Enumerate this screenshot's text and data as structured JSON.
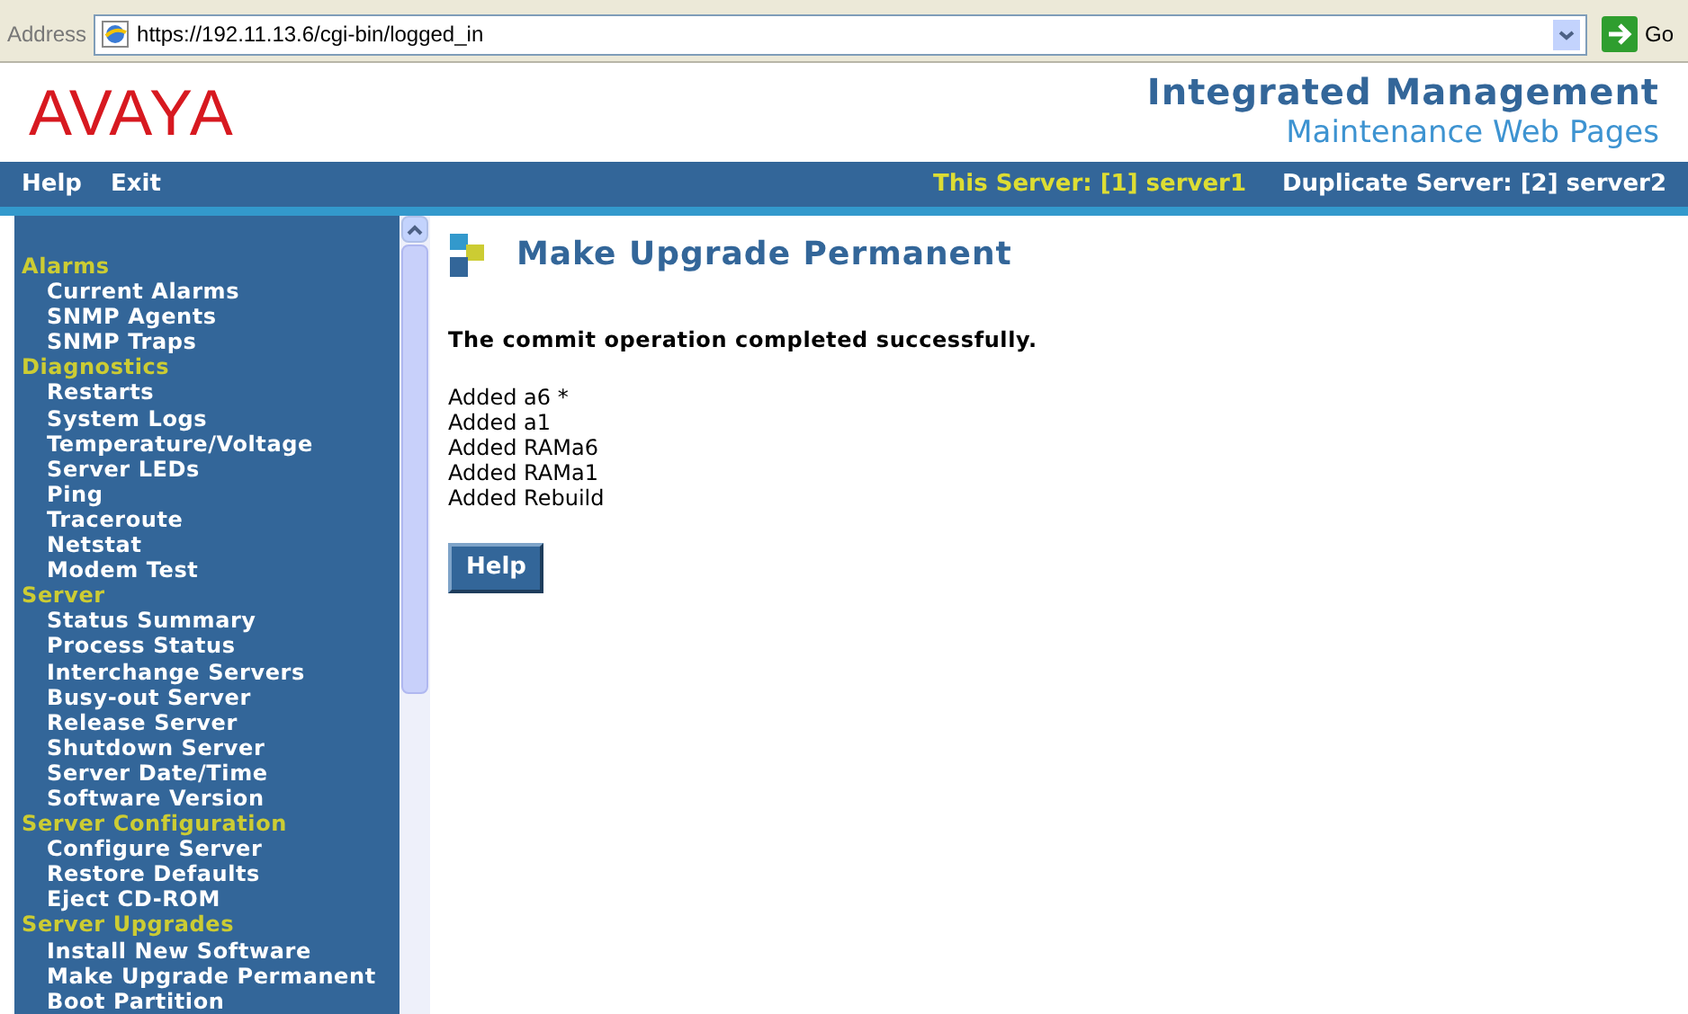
{
  "address_bar": {
    "label": "Address",
    "url": "https://192.11.13.6/cgi-bin/logged_in",
    "go_label": "Go"
  },
  "header": {
    "logo": "AVAYA",
    "title": "Integrated Management",
    "subtitle": "Maintenance Web Pages"
  },
  "nav": {
    "links": [
      "Help",
      "Exit"
    ],
    "this_server": "This Server: [1] server1",
    "duplicate_server": "Duplicate Server: [2] server2"
  },
  "sidebar": {
    "groups": [
      {
        "title": "Alarms",
        "items": [
          "Current Alarms",
          "SNMP Agents",
          "SNMP Traps"
        ]
      },
      {
        "title": "Diagnostics",
        "items": [
          "Restarts",
          "System Logs",
          "Temperature/Voltage",
          "Server LEDs",
          "Ping",
          "Traceroute",
          "Netstat",
          "Modem Test"
        ]
      },
      {
        "title": "Server",
        "items": [
          "Status Summary",
          "Process Status",
          "Interchange Servers",
          "Busy-out Server",
          "Release Server",
          "Shutdown Server",
          "Server Date/Time",
          "Software Version"
        ]
      },
      {
        "title": "Server Configuration",
        "items": [
          "Configure Server",
          "Restore Defaults",
          "Eject CD-ROM"
        ]
      },
      {
        "title": "Server Upgrades",
        "items": [
          "Install New Software",
          "Make Upgrade Permanent",
          "Boot Partition"
        ]
      }
    ]
  },
  "content": {
    "title": "Make Upgrade Permanent",
    "message": "The commit operation completed successfully.",
    "lines": [
      "Added a6 *",
      "Added a1",
      "Added RAMa6",
      "Added RAMa1",
      "Added Rebuild"
    ],
    "button": "Help"
  }
}
